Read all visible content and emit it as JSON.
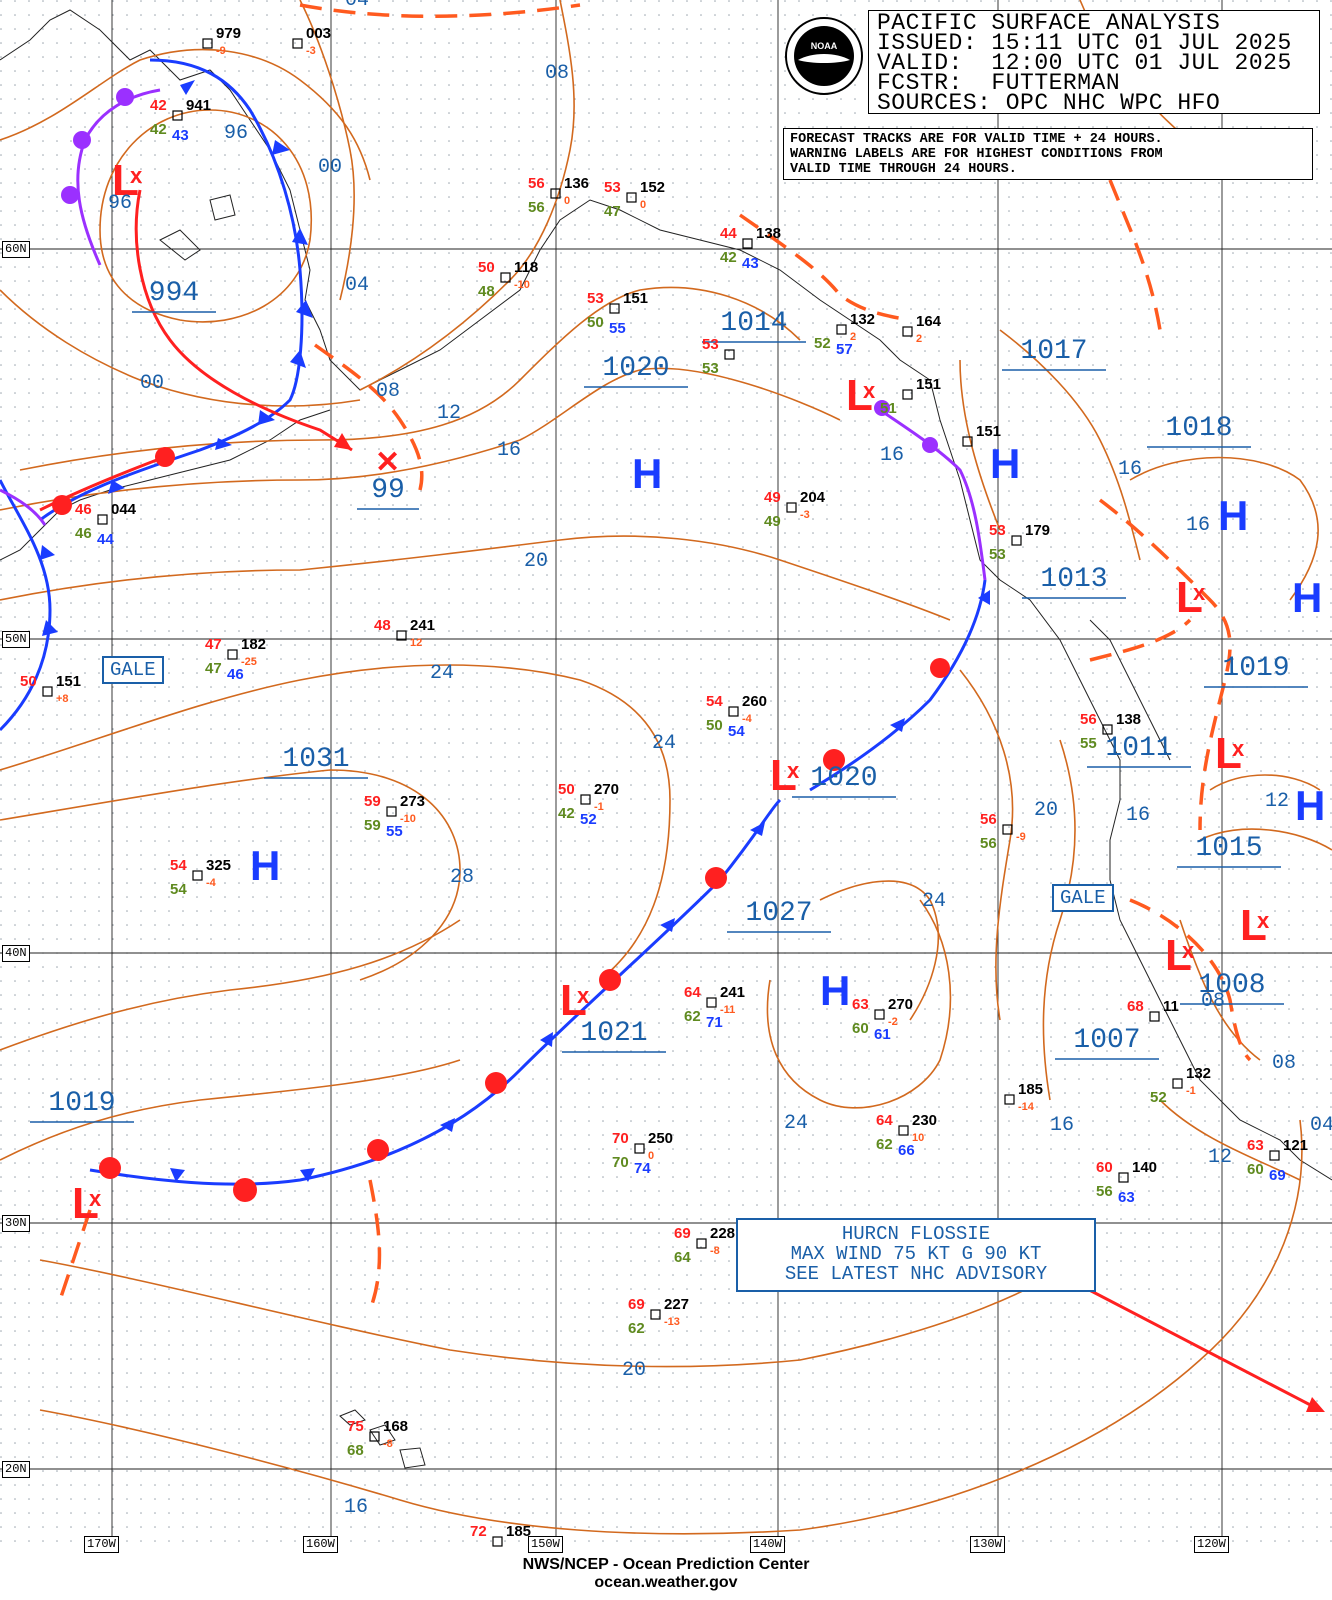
{
  "header": {
    "title": "PACIFIC SURFACE ANALYSIS",
    "issued": "ISSUED: 15:11 UTC 01 JUL 2025",
    "valid": "VALID:  12:00 UTC 01 JUL 2025",
    "fcstr": "FCSTR:  FUTTERMAN",
    "sources": "SOURCES: OPC NHC WPC HFO"
  },
  "note": {
    "line1": "FORECAST TRACKS ARE FOR VALID TIME + 24 HOURS.",
    "line2": "WARNING LABELS ARE FOR HIGHEST CONDITIONS FROM",
    "line3": "VALID TIME THROUGH 24 HOURS."
  },
  "logo_text": "NOAA",
  "hurricane_box": {
    "line1": "HURCN FLOSSIE",
    "line2": "MAX WIND 75 KT G 90 KT",
    "line3": "SEE LATEST NHC ADVISORY"
  },
  "gale_labels": [
    "GALE",
    "GALE"
  ],
  "footer": {
    "line1": "NWS/NCEP - Ocean Prediction Center",
    "line2": "ocean.weather.gov"
  },
  "latitude_labels": [
    "60N",
    "50N",
    "40N",
    "30N",
    "20N"
  ],
  "longitude_labels": [
    "170W",
    "160W",
    "150W",
    "140W",
    "130W",
    "120W"
  ],
  "pressure_centers": [
    {
      "type": "L",
      "value": "994"
    },
    {
      "type": "X",
      "value": "99"
    },
    {
      "type": "H",
      "value": "1020"
    },
    {
      "type": "L",
      "value": "1014"
    },
    {
      "type": "L",
      "value": "1017"
    },
    {
      "type": "H",
      "value": "1018"
    },
    {
      "type": "L",
      "value": "1013"
    },
    {
      "type": "H",
      "value": "1019"
    },
    {
      "type": "L",
      "value": "1011"
    },
    {
      "type": "H",
      "value": "1031"
    },
    {
      "type": "L",
      "value": "1020"
    },
    {
      "type": "H",
      "value": "1015"
    },
    {
      "type": "H",
      "value": "1027"
    },
    {
      "type": "L",
      "value": "1021"
    },
    {
      "type": "L",
      "value": "1008"
    },
    {
      "type": "L",
      "value": "1007"
    },
    {
      "type": "L",
      "value": "1019"
    }
  ],
  "isobar_labels": [
    "04",
    "08",
    "96",
    "00",
    "96",
    "04",
    "00",
    "08",
    "12",
    "16",
    "20",
    "24",
    "24",
    "28",
    "16",
    "16",
    "16",
    "20",
    "12",
    "16",
    "24",
    "24",
    "08",
    "12",
    "08",
    "16",
    "20",
    "16",
    "04"
  ],
  "stations": [
    {
      "t": "42",
      "d": "42",
      "p": "941",
      "w": "43"
    },
    {
      "t": "",
      "d": "",
      "p": "979",
      "x": "-9"
    },
    {
      "t": "",
      "d": "",
      "p": "003",
      "x": "-3"
    },
    {
      "t": "56",
      "d": "56",
      "p": "136",
      "x": "0"
    },
    {
      "t": "53",
      "d": "47",
      "p": "152",
      "x": "0"
    },
    {
      "t": "44",
      "d": "42",
      "p": "138",
      "w": "43"
    },
    {
      "t": "50",
      "d": "48",
      "p": "118",
      "x": "-10"
    },
    {
      "t": "53",
      "d": "50",
      "p": "151",
      "w": "55"
    },
    {
      "t": "53",
      "d": "53",
      "p": ""
    },
    {
      "t": "",
      "d": "52",
      "p": "132",
      "w": "57",
      "x": "2"
    },
    {
      "t": "",
      "d": "",
      "p": "164",
      "x": "2"
    },
    {
      "t": "",
      "d": "51",
      "p": "151"
    },
    {
      "t": "",
      "d": "",
      "p": "151"
    },
    {
      "t": "46",
      "d": "46",
      "p": "044",
      "w": "44"
    },
    {
      "t": "49",
      "d": "49",
      "p": "204",
      "x": "-3"
    },
    {
      "t": "53",
      "d": "53",
      "p": "179"
    },
    {
      "t": "47",
      "d": "47",
      "p": "182",
      "w": "46",
      "x": "-25"
    },
    {
      "t": "50",
      "d": "",
      "p": "151",
      "x": "+8"
    },
    {
      "t": "48",
      "d": "",
      "p": "241",
      "x": "12"
    },
    {
      "t": "54",
      "d": "50",
      "p": "260",
      "w": "54",
      "x": "-4"
    },
    {
      "t": "56",
      "d": "55",
      "p": "138"
    },
    {
      "t": "50",
      "d": "42",
      "p": "270",
      "w": "52",
      "x": "-1"
    },
    {
      "t": "59",
      "d": "59",
      "p": "273",
      "w": "55",
      "x": "-10"
    },
    {
      "t": "56",
      "d": "56",
      "p": "",
      "x": "-9"
    },
    {
      "t": "54",
      "d": "54",
      "p": "325",
      "x": "-4"
    },
    {
      "t": "64",
      "d": "62",
      "p": "241",
      "w": "71",
      "x": "-11"
    },
    {
      "t": "63",
      "d": "60",
      "p": "270",
      "w": "61",
      "x": "-2"
    },
    {
      "t": "68",
      "d": "",
      "p": "11"
    },
    {
      "t": "",
      "d": "52",
      "p": "132",
      "x": "-1"
    },
    {
      "t": "",
      "d": "",
      "p": "185",
      "x": "-14"
    },
    {
      "t": "64",
      "d": "62",
      "p": "230",
      "w": "66",
      "x": "10"
    },
    {
      "t": "70",
      "d": "70",
      "p": "250",
      "w": "74",
      "x": "0"
    },
    {
      "t": "60",
      "d": "56",
      "p": "140",
      "w": "63"
    },
    {
      "t": "63",
      "d": "60",
      "p": "121",
      "w": "69"
    },
    {
      "t": "69",
      "d": "64",
      "p": "228",
      "x": "-8"
    },
    {
      "t": "69",
      "d": "62",
      "p": "227",
      "x": "-13"
    },
    {
      "t": "75",
      "d": "68",
      "p": "168",
      "x": "-8"
    },
    {
      "t": "72",
      "d": "",
      "p": "185"
    }
  ]
}
